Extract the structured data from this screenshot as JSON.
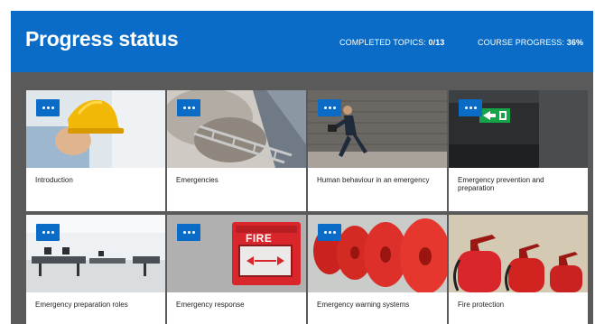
{
  "header": {
    "title": "Progress status",
    "completed_label": "COMPLETED TOPICS:",
    "completed_value": "0/13",
    "progress_label": "COURSE PROGRESS:",
    "progress_value": "36%"
  },
  "topics": [
    {
      "label": "Introduction",
      "image": "hard-hat-image"
    },
    {
      "label": "Emergencies",
      "image": "fire-ladder-image"
    },
    {
      "label": "Human behaviour in an emergency",
      "image": "running-man-image"
    },
    {
      "label": "Emergency prevention and preparation",
      "image": "exit-sign-image"
    },
    {
      "label": "Emergency preparation roles",
      "image": "office-image"
    },
    {
      "label": "Emergency response",
      "image": "fire-alarm-image"
    },
    {
      "label": "Emergency warning systems",
      "image": "alarm-bells-image"
    },
    {
      "label": "Fire protection",
      "image": "fire-extinguishers-image"
    }
  ],
  "colors": {
    "accent": "#0a6cc7",
    "background": "#5a5a5a",
    "card": "#ffffff"
  },
  "icons": {
    "menu": "more-dots-icon"
  }
}
